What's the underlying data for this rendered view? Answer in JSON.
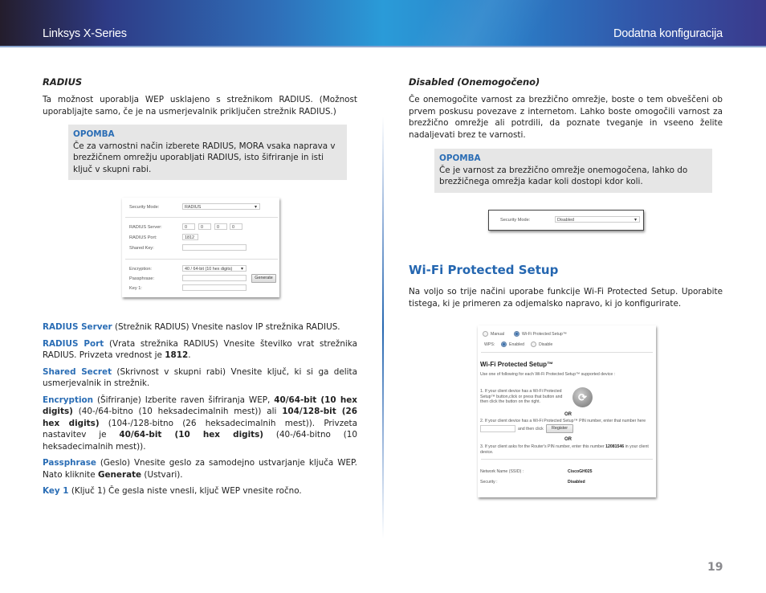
{
  "header": {
    "left_title": "Linksys X-Series",
    "right_title": "Dodatna konfiguracija"
  },
  "left": {
    "radius_heading": "RADIUS",
    "radius_intro": "Ta možnost uporablja WEP usklajeno s strežnikom RADIUS. (Možnost uporabljajte samo, če je na usmerjevalnik priključen strežnik RADIUS.)",
    "note": {
      "title": "OPOMBA",
      "text": "Če za varnostni način izberete RADIUS, MORA vsaka naprava v brezžičnem omrežju uporabljati RADIUS, isto šifriranje in isti ključ v skupni rabi."
    },
    "screenshot": {
      "security_mode_label": "Security Mode:",
      "security_mode_value": "RADIUS",
      "radius_server_label": "RADIUS Server:",
      "radius_server_octets": [
        "0",
        "0",
        "0",
        "0"
      ],
      "radius_port_label": "RADIUS Port:",
      "radius_port_value": "1812",
      "shared_key_label": "Shared Key:",
      "shared_key_value": "",
      "encryption_label": "Encryption:",
      "encryption_value": "40 / 64-bit (10 hex digits)",
      "passphrase_label": "Passphrase:",
      "passphrase_value": "",
      "generate_button": "Generate",
      "key1_label": "Key 1:",
      "key1_value": ""
    },
    "definitions": [
      {
        "term": "RADIUS Server",
        "text": " (Strežnik RADIUS)  Vnesite naslov IP strežnika RADIUS."
      },
      {
        "term": "RADIUS Port",
        "text": " (Vrata strežnika RADIUS)  Vnesite številko vrat strežnika RADIUS. Privzeta vrednost je ",
        "bold": "1812",
        "tail": "."
      },
      {
        "term": "Shared Secret",
        "text": " (Skrivnost v skupni rabi) Vnesite ključ, ki si ga delita usmerjevalnik in strežnik."
      },
      {
        "term": "Encryption",
        "text1": " (Šifriranje)  Izberite raven šifriranja WEP, ",
        "bold1": "40/64-bit (10 hex digits)",
        "text2": " (40-/64-bitno (10 heksadecimalnih mest)) ali ",
        "bold2": "104/128-bit (26 hex digits)",
        "text3": " (104-/128-bitno (26 heksadecimalnih mest)). Privzeta nastavitev je ",
        "bold3": "40/64-bit (10 hex digits)",
        "text4": " (40-/64-bitno (10 heksadecimalnih mest))."
      },
      {
        "term": "Passphrase",
        "text": " (Geslo)  Vnesite geslo za samodejno ustvarjanje ključa WEP. Nato kliknite ",
        "bold": "Generate",
        "tail": " (Ustvari)."
      },
      {
        "term": "Key 1",
        "text": " (Ključ 1)  Če gesla niste vnesli, ključ WEP vnesite ročno."
      }
    ]
  },
  "right": {
    "disabled_heading": "Disabled (Onemogočeno)",
    "disabled_text": "Če onemogočite varnost za brezžično omrežje, boste o tem obveščeni ob prvem poskusu povezave z internetom. Lahko boste omogočili varnost za brezžično omrežje ali potrdili, da poznate tveganje in vseeno želite nadaljevati brez te varnosti.",
    "note": {
      "title": "OPOMBA",
      "text": "Če je varnost za brezžično omrežje onemogočena, lahko do brezžičnega omrežja kadar koli dostopi kdor koli."
    },
    "disabled_shot": {
      "security_mode_label": "Security Mode:",
      "security_mode_value": "Disabled"
    },
    "wps_heading": "Wi-Fi Protected Setup",
    "wps_intro": "Na voljo so trije načini uporabe funkcije Wi-Fi Protected Setup. Uporabite tistega, ki je primeren za odjemalsko napravo, ki jo konfigurirate.",
    "wps_shot": {
      "radio_manual": "Manual",
      "radio_wps": "Wi-Fi Protected Setup™",
      "wps_label": "WPS:",
      "radio_enabled": "Enabled",
      "radio_disable": "Disable",
      "title": "Wi-Fi Protected Setup™",
      "instruction": "Use one of following for each Wi-Fi Protected Setup™ supported device :",
      "step1": "1. If your client device has a Wi-Fi Protected Setup™ button,click or press that button and then click the button on the right.",
      "or1": "OR",
      "step2": "2. If your client device has a Wi-Fi Protected Setup™ PIN number, enter that number here",
      "step2b": "and then click",
      "register_button": "Register",
      "pin_value": "",
      "or2": "OR",
      "step3_pre": "3. If your client asks for the Router's PIN number, enter this number ",
      "router_pin": "12081546",
      "step3_post": " in your client device.",
      "ssid_label": "Network Name (SSID) :",
      "ssid_value": "CiscoGH025",
      "security_label": "Security :",
      "security_value": "Disabled"
    }
  },
  "page_number": "19"
}
